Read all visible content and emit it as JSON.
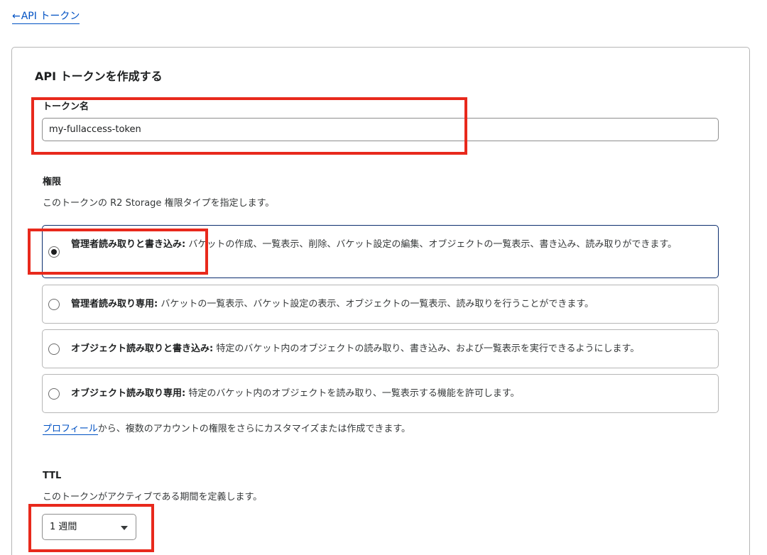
{
  "back_link": {
    "arrow": "←",
    "label": "API トークン"
  },
  "form": {
    "title": "API トークンを作成する",
    "token_name": {
      "label": "トークン名",
      "value": "my-fullaccess-token",
      "placeholder": ""
    },
    "permissions": {
      "label": "権限",
      "description": "このトークンの R2 Storage 権限タイプを指定します。",
      "options": [
        {
          "title": "管理者読み取りと書き込み:",
          "description": " バケットの作成、一覧表示、削除、バケット設定の編集、オブジェクトの一覧表示、書き込み、読み取りができます。",
          "selected": true
        },
        {
          "title": "管理者読み取り専用:",
          "description": " バケットの一覧表示、バケット設定の表示、オブジェクトの一覧表示、読み取りを行うことができます。",
          "selected": false
        },
        {
          "title": "オブジェクト読み取りと書き込み:",
          "description": " 特定のバケット内のオブジェクトの読み取り、書き込み、および一覧表示を実行できるようにします。",
          "selected": false
        },
        {
          "title": "オブジェクト読み取り専用:",
          "description": " 特定のバケット内のオブジェクトを読み取り、一覧表示する機能を許可します。",
          "selected": false
        }
      ],
      "profile_link": "プロフィール",
      "profile_suffix": "から、複数のアカウントの権限をさらにカスタマイズまたは作成できます。"
    },
    "ttl": {
      "label": "TTL",
      "description": "このトークンがアクティブである期間を定義します。",
      "selected_value": "1 週間"
    }
  },
  "colors": {
    "link": "#0051c3",
    "highlight_box": "#e8291c",
    "selected_border": "#0b2d6e"
  },
  "icons": {
    "back": "left-arrow-icon",
    "dropdown": "caret-down-icon",
    "radio_checked": "radio-checked-icon",
    "radio_unchecked": "radio-unchecked-icon"
  }
}
